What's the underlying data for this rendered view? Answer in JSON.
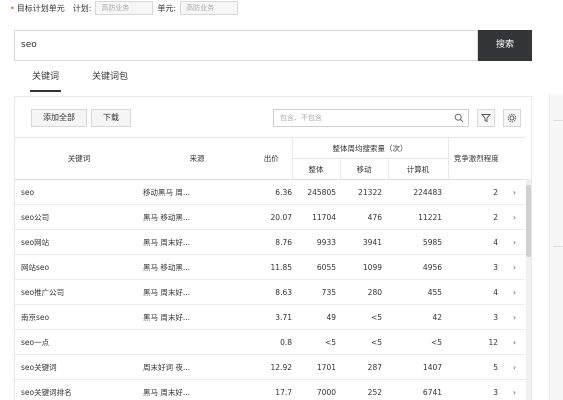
{
  "target": {
    "bullet": "•",
    "title": "目标计划单元",
    "plan_label": "计划:",
    "plan_value": "高防业务",
    "unit_label": "单元:",
    "unit_value": "高防业务"
  },
  "search": {
    "value": "seo",
    "button_label": "搜索"
  },
  "tabs": {
    "keywords": "关键词",
    "keyword_package": "关键词包"
  },
  "toolbar": {
    "add_all": "添加全部",
    "download": "下载",
    "filter_placeholder": "包含、不包含"
  },
  "table": {
    "headers": {
      "keyword": "关键词",
      "source": "来源",
      "bid": "出价",
      "weekly_avg": "整体周均搜索量（次）",
      "overall": "整体",
      "mobile": "移动",
      "pc": "计算机",
      "competition": "竞争激烈程度"
    },
    "rows": [
      {
        "keyword": "seo",
        "source": "移动黑马 周...",
        "bid": "6.36",
        "overall": "245805",
        "mobile": "21322",
        "pc": "224483",
        "competition": "2",
        "action": "›"
      },
      {
        "keyword": "seo公司",
        "source": "黑马 移动黑...",
        "bid": "20.07",
        "overall": "11704",
        "mobile": "476",
        "pc": "11221",
        "competition": "2",
        "action": "›"
      },
      {
        "keyword": "seo网站",
        "source": "黑马 周末好...",
        "bid": "8.76",
        "overall": "9933",
        "mobile": "3941",
        "pc": "5985",
        "competition": "4",
        "action": "›"
      },
      {
        "keyword": "网站seo",
        "source": "黑马 移动黑...",
        "bid": "11.85",
        "overall": "6055",
        "mobile": "1099",
        "pc": "4956",
        "competition": "3",
        "action": "›"
      },
      {
        "keyword": "seo推广公司",
        "source": "黑马 周末好...",
        "bid": "8.63",
        "overall": "735",
        "mobile": "280",
        "pc": "455",
        "competition": "4",
        "action": "›"
      },
      {
        "keyword": "南京seo",
        "source": "黑马 周末好...",
        "bid": "3.71",
        "overall": "49",
        "mobile": "<5",
        "pc": "42",
        "competition": "3",
        "action": "›"
      },
      {
        "keyword": "seo一点",
        "source": "",
        "bid": "0.8",
        "overall": "<5",
        "mobile": "<5",
        "pc": "<5",
        "competition": "12",
        "action": "›"
      },
      {
        "keyword": "seo关键词",
        "source": "周末好词 夜...",
        "bid": "12.92",
        "overall": "1701",
        "mobile": "287",
        "pc": "1407",
        "competition": "5",
        "action": "›"
      },
      {
        "keyword": "seo关键词排名",
        "source": "黑马 周末好...",
        "bid": "17.7",
        "overall": "7000",
        "mobile": "252",
        "pc": "6741",
        "competition": "3",
        "action": "›"
      }
    ]
  }
}
